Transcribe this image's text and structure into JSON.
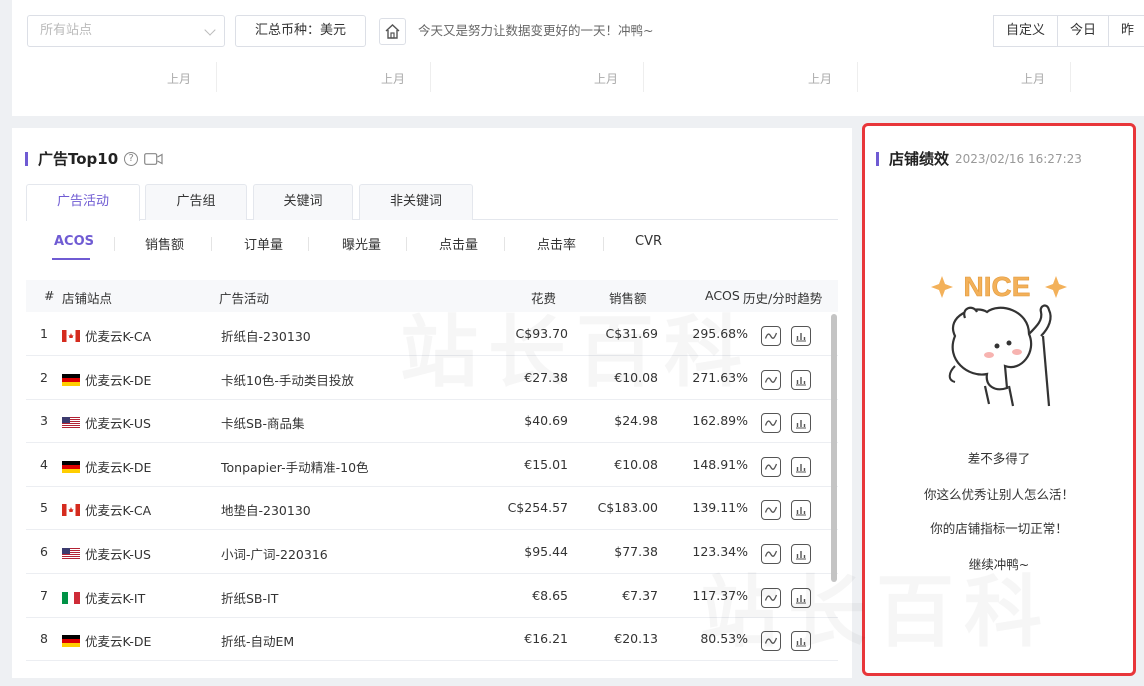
{
  "topbar": {
    "site_placeholder": "所有站点",
    "currency_label": "汇总币种：美元",
    "motto": "今天又是努力让数据变更好的一天！冲鸭~",
    "ranges": [
      "自定义",
      "今日",
      "昨"
    ],
    "month_labels": [
      "上月",
      "上月",
      "上月",
      "上月",
      "上月"
    ]
  },
  "ad_panel": {
    "title": "广告Top10",
    "tabs": [
      "广告活动",
      "广告组",
      "关键词",
      "非关键词"
    ],
    "active_tab": 0,
    "metrics": [
      "ACOS",
      "销售额",
      "订单量",
      "曝光量",
      "点击量",
      "点击率",
      "CVR"
    ],
    "active_metric": 0,
    "columns": {
      "index": "#",
      "store": "店铺站点",
      "campaign": "广告活动",
      "spend": "花费",
      "sales": "销售额",
      "acos": "ACOS",
      "trend": "历史/分时趋势"
    },
    "rows": [
      {
        "rank": "1",
        "flag": "CA",
        "store": "优麦云K-CA",
        "campaign": "折纸自-230130",
        "spend": "C$93.70",
        "sales": "C$31.69",
        "acos": "295.68%"
      },
      {
        "rank": "2",
        "flag": "DE",
        "store": "优麦云K-DE",
        "campaign": "卡纸10色-手动类目投放",
        "spend": "€27.38",
        "sales": "€10.08",
        "acos": "271.63%"
      },
      {
        "rank": "3",
        "flag": "US",
        "store": "优麦云K-US",
        "campaign": "卡纸SB-商品集",
        "spend": "$40.69",
        "sales": "$24.98",
        "acos": "162.89%"
      },
      {
        "rank": "4",
        "flag": "DE",
        "store": "优麦云K-DE",
        "campaign": "Tonpapier-手动精准-10色",
        "spend": "€15.01",
        "sales": "€10.08",
        "acos": "148.91%"
      },
      {
        "rank": "5",
        "flag": "CA",
        "store": "优麦云K-CA",
        "campaign": "地垫自-230130",
        "spend": "C$254.57",
        "sales": "C$183.00",
        "acos": "139.11%"
      },
      {
        "rank": "6",
        "flag": "US",
        "store": "优麦云K-US",
        "campaign": "小词-广词-220316",
        "spend": "$95.44",
        "sales": "$77.38",
        "acos": "123.34%"
      },
      {
        "rank": "7",
        "flag": "IT",
        "store": "优麦云K-IT",
        "campaign": "折纸SB-IT",
        "spend": "€8.65",
        "sales": "€7.37",
        "acos": "117.37%"
      },
      {
        "rank": "8",
        "flag": "DE",
        "store": "优麦云K-DE",
        "campaign": "折纸-自动EM",
        "spend": "€16.21",
        "sales": "€20.13",
        "acos": "80.53%"
      }
    ]
  },
  "store_panel": {
    "title": "店铺绩效",
    "timestamp": "2023/02/16 16:27:23",
    "sticker_text": "NICE",
    "messages": [
      "差不多得了",
      "你这么优秀让别人怎么活！",
      "你的店铺指标一切正常！",
      "继续冲鸭~"
    ]
  },
  "colors": {
    "accent": "#6f5bd3",
    "highlight_border": "#e8363a"
  }
}
